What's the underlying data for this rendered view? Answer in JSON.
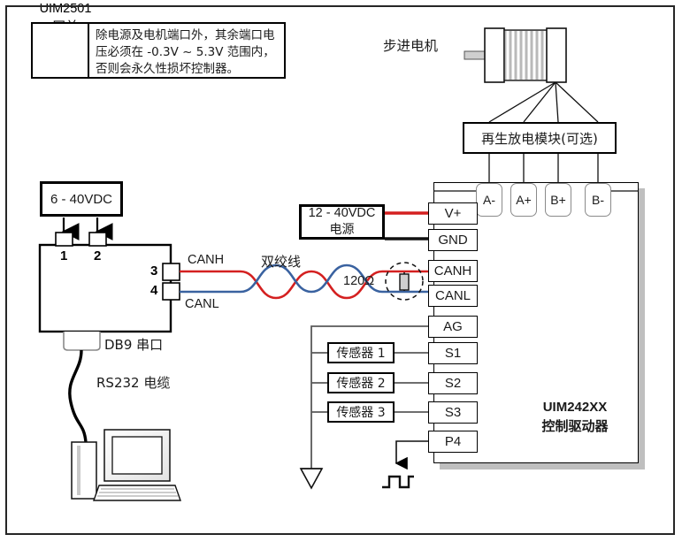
{
  "warning": {
    "icon": "warning-triangle-icon",
    "text": "除电源及电机端口外，其余端口电压必须在 -0.3V ~ 5.3V 范围内，否则会永久性损坏控制器。"
  },
  "motor": {
    "label": "步进电机",
    "icon": "stepper-motor-icon"
  },
  "regen_module": {
    "label": "再生放电模块(可选)"
  },
  "motor_terminals": [
    {
      "label": "A-"
    },
    {
      "label": "A+"
    },
    {
      "label": "B+"
    },
    {
      "label": "B-"
    }
  ],
  "power_supply_gateway": {
    "label": "6 - 40VDC"
  },
  "gateway": {
    "name": "UIM2501",
    "subtitle": "网关",
    "pins": [
      {
        "number": "1"
      },
      {
        "number": "2"
      },
      {
        "number": "3"
      },
      {
        "number": "4"
      }
    ],
    "can_high_label": "CANH",
    "can_low_label": "CANL",
    "db9_label": "DB9 串口",
    "cable_label": "RS232 电缆"
  },
  "twisted_pair": {
    "label": "双绞线",
    "resistor_label": "120Ω"
  },
  "driver_power": {
    "voltage": "12 - 40VDC",
    "label": "电源"
  },
  "driver": {
    "name": "UIM242XX",
    "subtitle": "控制驱动器",
    "terminals": [
      {
        "label": "V+"
      },
      {
        "label": "GND"
      },
      {
        "label": "CANH"
      },
      {
        "label": "CANL"
      },
      {
        "label": "AG"
      },
      {
        "label": "S1"
      },
      {
        "label": "S2"
      },
      {
        "label": "S3"
      },
      {
        "label": "P4"
      }
    ]
  },
  "sensors": [
    {
      "label": "传感器 1"
    },
    {
      "label": "传感器 2"
    },
    {
      "label": "传感器 3"
    }
  ],
  "symbols": {
    "ground": "ground-symbol",
    "pulse": "pulse-signal-symbol",
    "pc": "desktop-computer-icon"
  },
  "colors": {
    "wire_red": "#d42020",
    "wire_blue": "#3a62a0",
    "wire_black": "#111111",
    "wire_gray": "#7d7d7d",
    "frame": "#262626",
    "shadow": "#bfbfbf"
  }
}
